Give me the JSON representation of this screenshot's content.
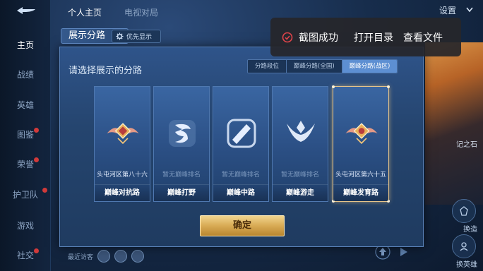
{
  "header": {
    "tabs": [
      "个人主页",
      "电视对局"
    ],
    "settings_label": "设置"
  },
  "sidebar": {
    "items": [
      {
        "label": "主页",
        "active": true,
        "badge": false
      },
      {
        "label": "战绩",
        "active": false,
        "badge": false
      },
      {
        "label": "英雄",
        "active": false,
        "badge": false
      },
      {
        "label": "图鉴",
        "active": false,
        "badge": true
      },
      {
        "label": "荣誉",
        "active": false,
        "badge": true
      },
      {
        "label": "护卫队",
        "active": false,
        "badge": true
      },
      {
        "label": "游戏",
        "active": false,
        "badge": false
      },
      {
        "label": "社交",
        "active": false,
        "badge": true
      }
    ]
  },
  "background": {
    "hero_caption": "记之石",
    "right_buttons": [
      "换造",
      "换英雄"
    ],
    "visitors_label": "最近访客"
  },
  "dialog": {
    "tab_title": "展示分路",
    "priority_label": "优先显示",
    "heading": "请选择展示的分路",
    "segments": [
      {
        "label": "分路段位",
        "active": false
      },
      {
        "label": "巅峰分路(全国)",
        "active": false
      },
      {
        "label": "巅峰分路(战区)",
        "active": true
      }
    ],
    "cards": [
      {
        "rank": "头屯河区第八十六",
        "lane": "巅峰对抗路",
        "icon": "rank-emblem-icon",
        "has_rank": true,
        "selected": false
      },
      {
        "rank": "暂无巅峰排名",
        "lane": "巅峰打野",
        "icon": "jungle-icon",
        "has_rank": false,
        "selected": false
      },
      {
        "rank": "暂无巅峰排名",
        "lane": "巅峰中路",
        "icon": "mid-lane-icon",
        "has_rank": false,
        "selected": false
      },
      {
        "rank": "暂无巅峰排名",
        "lane": "巅峰游走",
        "icon": "roam-icon",
        "has_rank": false,
        "selected": false
      },
      {
        "rank": "头屯河区第六十五",
        "lane": "巅峰发育路",
        "icon": "rank-emblem-icon",
        "has_rank": true,
        "selected": true
      }
    ],
    "confirm_label": "确定"
  },
  "toast": {
    "message": "截图成功",
    "open_folder": "打开目录",
    "view_file": "查看文件"
  }
}
